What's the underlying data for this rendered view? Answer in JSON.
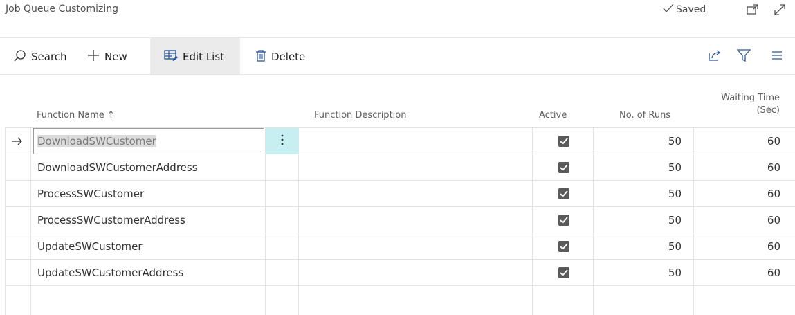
{
  "header": {
    "title": "Job Queue Customizing",
    "saved_label": "Saved",
    "icons": [
      "checkmark-icon",
      "open-new-window-icon",
      "expand-icon"
    ]
  },
  "toolbar": {
    "search_label": "Search",
    "new_label": "New",
    "edit_list_label": "Edit List",
    "delete_label": "Delete",
    "right_icons": [
      "share-icon",
      "filter-icon",
      "list-view-icon"
    ]
  },
  "table": {
    "columns": {
      "function_name": "Function Name ↑",
      "function_description": "Function Description",
      "active": "Active",
      "runs": "No. of Runs",
      "waiting_line1": "Waiting Time",
      "waiting_line2": "(Sec)"
    },
    "rows": [
      {
        "name": "DownloadSWCustomer",
        "description": "",
        "active": true,
        "runs": "50",
        "wait": "60"
      },
      {
        "name": "DownloadSWCustomerAddress",
        "description": "",
        "active": true,
        "runs": "50",
        "wait": "60"
      },
      {
        "name": "ProcessSWCustomer",
        "description": "",
        "active": true,
        "runs": "50",
        "wait": "60"
      },
      {
        "name": "ProcessSWCustomerAddress",
        "description": "",
        "active": true,
        "runs": "50",
        "wait": "60"
      },
      {
        "name": "UpdateSWCustomer",
        "description": "",
        "active": true,
        "runs": "50",
        "wait": "60"
      },
      {
        "name": "UpdateSWCustomerAddress",
        "description": "",
        "active": true,
        "runs": "50",
        "wait": "60"
      }
    ]
  },
  "colors": {
    "selected_text_bg": "#dcdcdc",
    "row_action_bg": "#c7eef0",
    "checkbox": "#5a5a5a",
    "active_action_bg": "#ebebeb"
  }
}
